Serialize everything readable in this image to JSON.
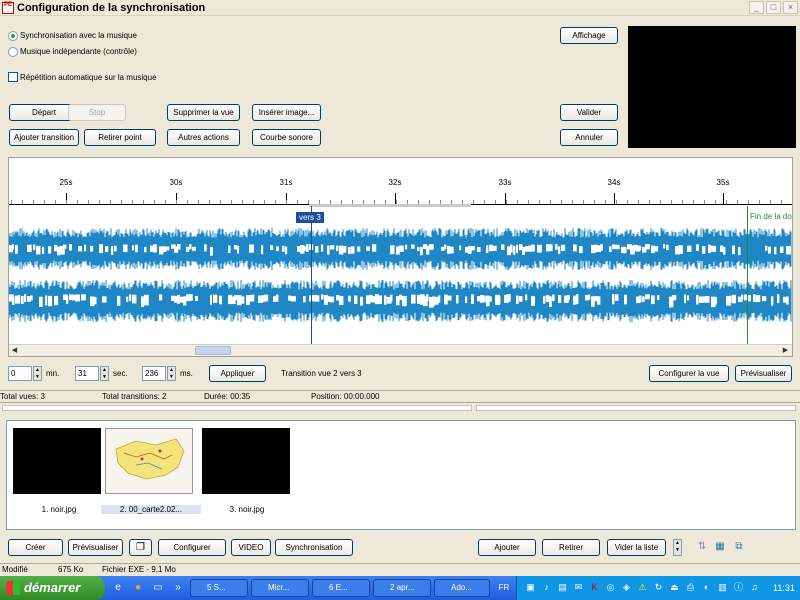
{
  "window": {
    "title": "Configuration de la synchronisation",
    "app_icon_text": "PE"
  },
  "options": {
    "radio_sync": "Synchronisation avec la musique",
    "radio_independent": "Musique indépendante (contrôle)",
    "checkbox_repeat": "Répétition automatique sur la musique",
    "selected": "sync"
  },
  "buttons": {
    "depart": "Départ",
    "stop": "Stop",
    "supprimer": "Supprimer la vue",
    "inserer": "Insérer image...",
    "ajouter_transition": "Ajouter transition",
    "retirer_point": "Retirer point",
    "autres_actions": "Autres actions",
    "courbe_sonore": "Courbe sonore",
    "affichage": "Affichage",
    "valider": "Valider",
    "annuler": "Annuler",
    "appliquer": "Appliquer",
    "configurer_vue": "Configurer la vue",
    "previsualiser": "Prévisualiser"
  },
  "timeline": {
    "ticks": [
      "25s",
      "30s",
      "31s",
      "32s",
      "33s",
      "34s",
      "35s"
    ],
    "cursor_label": "vers 3",
    "end_label": "Fin de la do",
    "wave_color": "#1f87c6"
  },
  "time_controls": {
    "minutes": "0",
    "min_unit": "mn.",
    "seconds": "31",
    "sec_unit": "sec.",
    "millis": "236",
    "ms_unit": "ms.",
    "transition_text": "Transition vue 2 vers 3"
  },
  "status": {
    "total_vues": "Total vues: 3",
    "total_transitions": "Total transitions: 2",
    "duree": "Durée: 00:35",
    "position": "Position: 00:00.000"
  },
  "thumbnails": [
    {
      "caption": "1. noir.jpg"
    },
    {
      "caption": "2. 00_carte2.02..."
    },
    {
      "caption": "3. noir.jpg"
    }
  ],
  "bottom_buttons": {
    "creer": "Créer",
    "previsualiser": "Prévisualiser",
    "configurer": "Configurer",
    "video": "VIDEO",
    "synchronisation": "Synchronisation",
    "ajouter": "Ajouter",
    "retirer": "Retirer",
    "vider": "Vider la liste"
  },
  "file_status": {
    "state": "Modifié",
    "size": "675 Ko",
    "file": "Fichier EXE - 9,1 Mo"
  },
  "taskbar": {
    "start": "démarrer",
    "items": [
      "5 S...",
      "Micr...",
      "6 E...",
      "2 apr...",
      "Ado..."
    ],
    "lang": "FR",
    "clock": "11:31"
  }
}
